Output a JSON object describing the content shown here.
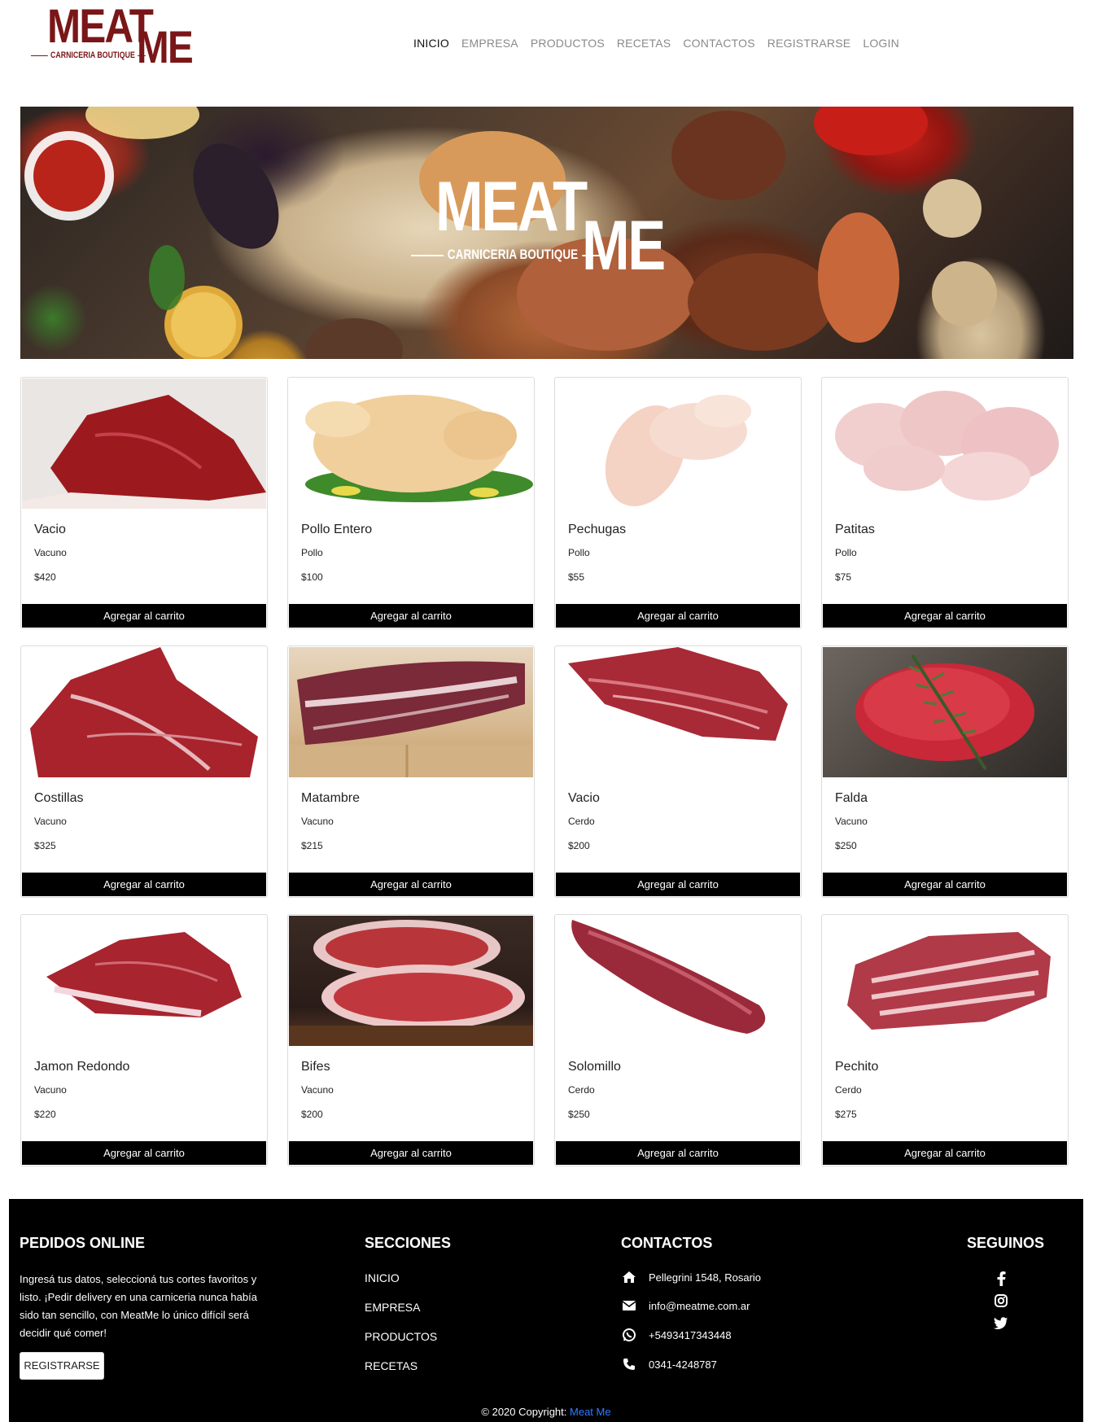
{
  "brand": {
    "logo_word1": "MEAT",
    "logo_word2": "ME",
    "logo_tagline": "CARNICERIA BOUTIQUE",
    "color": "#7a1618"
  },
  "nav": {
    "items": [
      "INICIO",
      "EMPRESA",
      "PRODUCTOS",
      "RECETAS",
      "CONTACTOS",
      "REGISTRARSE",
      "LOGIN"
    ],
    "active": "INICIO"
  },
  "hero": {
    "logo_word1": "MEAT",
    "logo_word2": "ME",
    "logo_tagline": "CARNICERIA BOUTIQUE"
  },
  "products": [
    {
      "name": "Vacio",
      "category": "Vacuno",
      "price": "$420",
      "button": "Agregar al carrito"
    },
    {
      "name": "Pollo Entero",
      "category": "Pollo",
      "price": "$100",
      "button": "Agregar al carrito"
    },
    {
      "name": "Pechugas",
      "category": "Pollo",
      "price": "$55",
      "button": "Agregar al carrito"
    },
    {
      "name": "Patitas",
      "category": "Pollo",
      "price": "$75",
      "button": "Agregar al carrito"
    },
    {
      "name": "Costillas",
      "category": "Vacuno",
      "price": "$325",
      "button": "Agregar al carrito"
    },
    {
      "name": "Matambre",
      "category": "Vacuno",
      "price": "$215",
      "button": "Agregar al carrito"
    },
    {
      "name": "Vacio",
      "category": "Cerdo",
      "price": "$200",
      "button": "Agregar al carrito"
    },
    {
      "name": "Falda",
      "category": "Vacuno",
      "price": "$250",
      "button": "Agregar al carrito"
    },
    {
      "name": "Jamon Redondo",
      "category": "Vacuno",
      "price": "$220",
      "button": "Agregar al carrito"
    },
    {
      "name": "Bifes",
      "category": "Vacuno",
      "price": "$200",
      "button": "Agregar al carrito"
    },
    {
      "name": "Solomillo",
      "category": "Cerdo",
      "price": "$250",
      "button": "Agregar al carrito"
    },
    {
      "name": "Pechito",
      "category": "Cerdo",
      "price": "$275",
      "button": "Agregar al carrito"
    }
  ],
  "footer": {
    "pedidos": {
      "title": "PEDIDOS ONLINE",
      "text": "Ingresá tus datos, seleccioná tus cortes favoritos y listo. ¡Pedir delivery en una carniceria nunca había sido tan sencillo, con MeatMe lo único difícil será decidir qué comer!",
      "button": "REGISTRARSE"
    },
    "secciones": {
      "title": "SECCIONES",
      "links": [
        "INICIO",
        "EMPRESA",
        "PRODUCTOS",
        "RECETAS"
      ]
    },
    "contactos": {
      "title": "CONTACTOS",
      "address": "Pellegrini 1548, Rosario",
      "email": "info@meatme.com.ar",
      "whatsapp": "+5493417343448",
      "phone": "0341-4248787"
    },
    "seguinos": {
      "title": "SEGUINOS",
      "icons": [
        "facebook-icon",
        "instagram-icon",
        "twitter-icon"
      ]
    },
    "copyright_text": "© 2020 Copyright:",
    "copyright_link": "Meat Me",
    "link_color": "#2f7bff"
  }
}
